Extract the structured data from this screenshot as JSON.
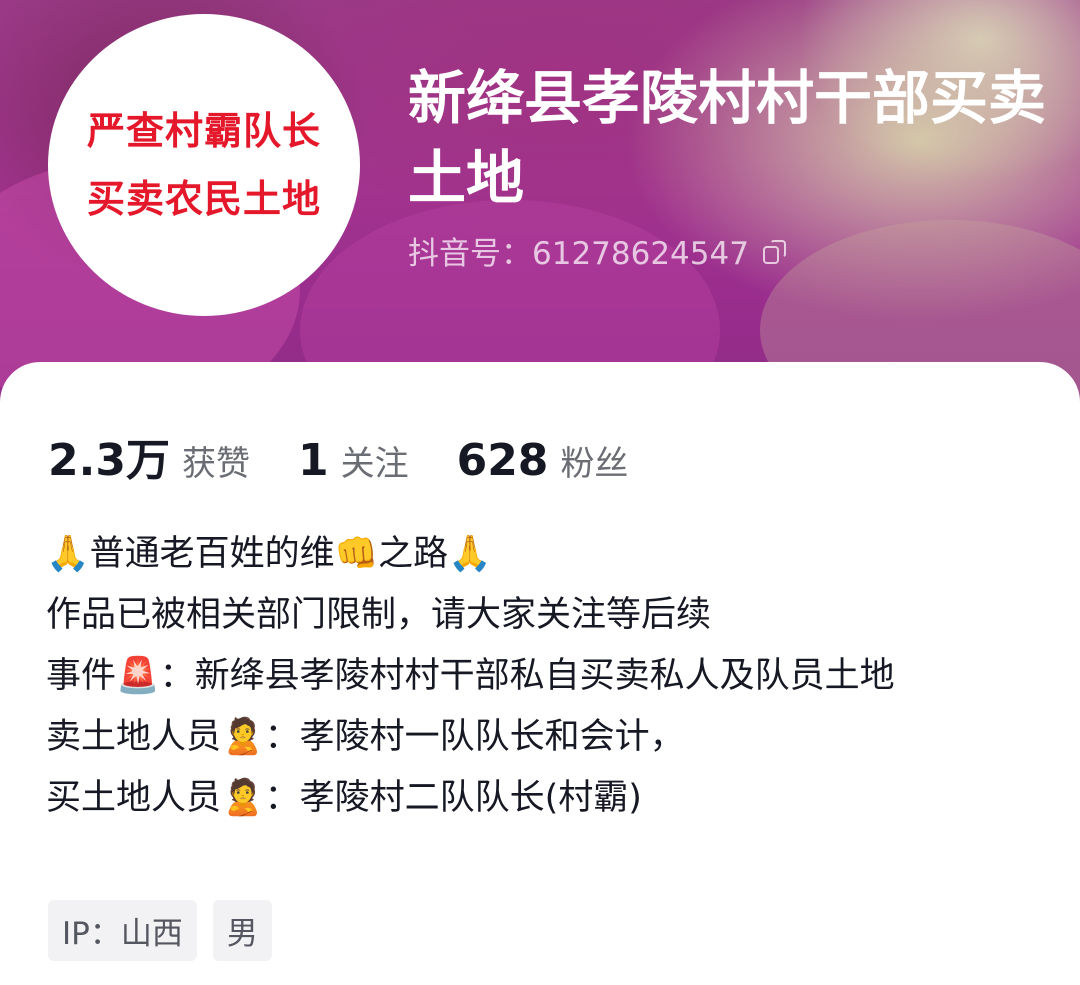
{
  "profile": {
    "avatar_text_line1": "严查村霸队长",
    "avatar_text_line2": "买卖农民土地",
    "display_name": "新绛县孝陵村村干部买卖土地",
    "douyin_id": "抖音号：61278624547"
  },
  "stats": {
    "likes_value": "2.3万",
    "likes_label": "获赞",
    "following_value": "1",
    "following_label": "关注",
    "followers_value": "628",
    "followers_label": "粉丝"
  },
  "bio": {
    "line1": "🙏普通老百姓的维👊之路🙏",
    "line2": "作品已被相关部门限制，请大家关注等后续",
    "line3": "事件🚨：新绛县孝陵村村干部私自买卖私人及队员土地",
    "line4": "卖土地人员🙎：孝陵村一队队长和会计，",
    "line5": "买土地人员🙎：孝陵村二队队长(村霸)"
  },
  "tags": {
    "ip": "IP：山西",
    "gender": "男"
  },
  "colors": {
    "banner": "#9a2d8d",
    "avatar_text": "#e4182a",
    "stat_number": "#161823",
    "stat_label": "#6b6d74",
    "tag_bg": "#f2f2f4"
  },
  "icons": {
    "copy": "copy-icon"
  }
}
